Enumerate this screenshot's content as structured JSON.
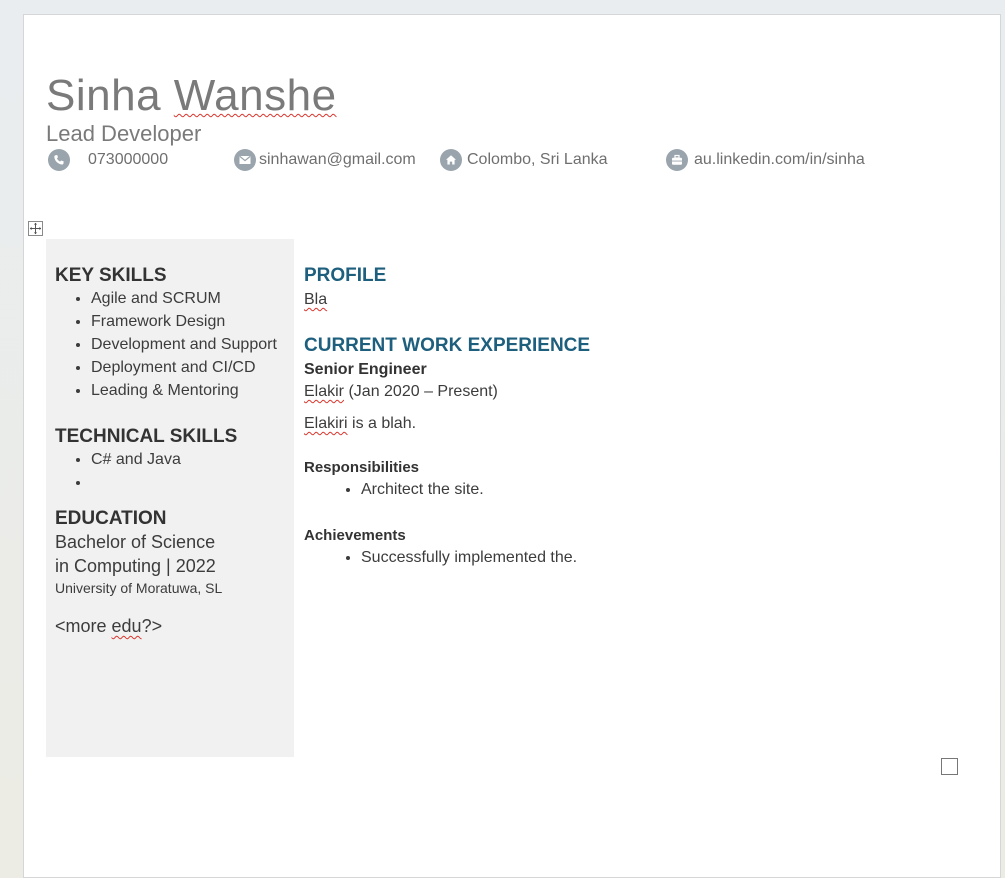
{
  "header": {
    "first_name": "Sinha",
    "last_name": "Wanshe",
    "job_title": "Lead Developer"
  },
  "contact": {
    "phone": "073000000",
    "email": "sinhawan@gmail.com",
    "location": "Colombo, Sri Lanka",
    "linkedin": "au.linkedin.com/in/sinha",
    "icons": [
      "phone-icon",
      "email-icon",
      "home-icon",
      "briefcase-icon"
    ],
    "icon_color": "#9aa4ad"
  },
  "sidebar": {
    "key_skills_heading": "KEY SKILLS",
    "key_skills": [
      "Agile and SCRUM",
      "Framework Design",
      "Development and Support",
      "Deployment and CI/CD",
      "Leading & Mentoring"
    ],
    "technical_skills_heading": "TECHNICAL SKILLS",
    "technical_skills": [
      "C# and Java",
      ""
    ],
    "education_heading": "EDUCATION",
    "degree_line1": "Bachelor of Science",
    "degree_line2": "in Computing | 2022",
    "university": "University of Moratuwa, SL",
    "more_edu_prefix": "<more ",
    "more_edu_word": "edu",
    "more_edu_suffix": "?>",
    "background_color": "#f1f1f1"
  },
  "main": {
    "profile_heading": "PROFILE",
    "profile_text": "Bla",
    "experience_heading": "CURRENT WORK EXPERIENCE",
    "role": "Senior Engineer",
    "company": "Elakir",
    "period": " (Jan 2020 – Present)",
    "company_desc_name": "Elakiri",
    "company_desc_rest": " is a blah.",
    "responsibilities_heading": "Responsibilities",
    "responsibilities": [
      "Architect the site."
    ],
    "achievements_heading": "Achievements",
    "achievements": [
      "Successfully implemented the."
    ],
    "heading_color": "#1e5f7e"
  }
}
